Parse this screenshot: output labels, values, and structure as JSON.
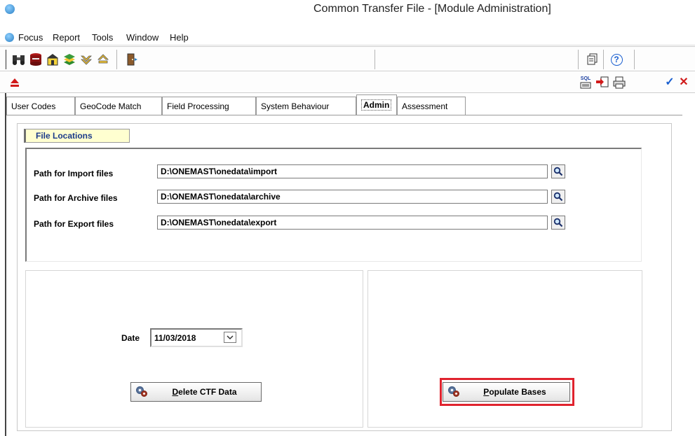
{
  "window": {
    "title": "Common Transfer File - [Module Administration]"
  },
  "menu": {
    "items": [
      "Focus",
      "Report",
      "Tools",
      "Window",
      "Help"
    ]
  },
  "toolbar": {
    "icons": [
      "binoculars-icon",
      "database-icon",
      "building-icon",
      "layers-icon",
      "arrow-down-icon",
      "arrow-up-icon",
      "exit-door-icon",
      "copy-pages-icon",
      "help-icon"
    ],
    "help_glyph": "?"
  },
  "toolbar2": {
    "sql_label": "SQL",
    "icons": [
      "eject-icon",
      "sql-report-icon",
      "import-icon",
      "print-icon",
      "confirm-check-icon",
      "cancel-x-icon"
    ]
  },
  "tabs": [
    "User Codes",
    "GeoCode Match",
    "Field Processing",
    "System Behaviour",
    "Admin",
    "Assessment"
  ],
  "active_tab": "Admin",
  "file_locations": {
    "header": "File Locations",
    "paths": [
      {
        "label": "Path for Import files",
        "value": "D:\\ONEMAST\\onedata\\import"
      },
      {
        "label": "Path for Archive files",
        "value": "D:\\ONEMAST\\onedata\\archive"
      },
      {
        "label": "Path for Export files",
        "value": "D:\\ONEMAST\\onedata\\export"
      }
    ]
  },
  "date_section": {
    "label": "Date",
    "value": "11/03/2018"
  },
  "buttons": {
    "delete_ctf_prefix": "D",
    "delete_ctf_rest": "elete CTF Data",
    "populate_prefix": "P",
    "populate_rest": "opulate Bases"
  },
  "colors": {
    "highlight": "#e0232e",
    "header_bg": "#ffffd0",
    "header_text": "#1b3a8a",
    "confirm": "#1a5fd0",
    "cancel": "#d01a1a"
  }
}
